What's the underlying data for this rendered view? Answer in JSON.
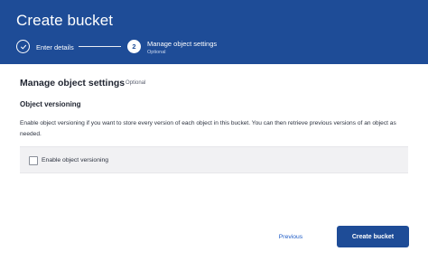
{
  "dialog": {
    "title": "Create bucket"
  },
  "steps": [
    {
      "number": "1",
      "label": "Enter details",
      "status": "complete",
      "icon": "check-icon"
    },
    {
      "number": "2",
      "label": "Manage object settings",
      "sublabel": "Optional",
      "status": "current"
    }
  ],
  "section": {
    "title": "Manage object settings",
    "optional_tag": "Optional"
  },
  "versioning": {
    "heading": "Object versioning",
    "description": "Enable object versioning if you want to store every version of each object in this bucket. You can then retrieve previous versions of an object as needed.",
    "checkbox_label": "Enable object versioning",
    "checked": false
  },
  "footer": {
    "previous_label": "Previous",
    "primary_label": "Create bucket"
  },
  "colors": {
    "header_bg": "#1e4c97",
    "accent": "#1e5bc6",
    "panel_bg": "#f1f1f3"
  }
}
